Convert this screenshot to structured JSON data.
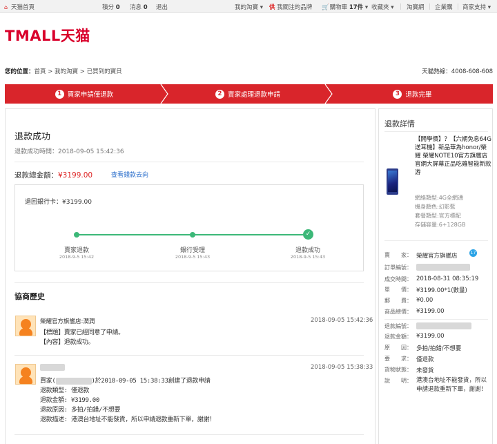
{
  "topbar": {
    "home": "天猫首頁",
    "points_label": "積分",
    "points_value": "0",
    "msg_label": "消息",
    "msg_value": "0",
    "logout": "退出",
    "my_taobao": "我的淘寶",
    "fav_badge": "供",
    "followed_brands": "我關注的品牌",
    "cart_label": "購物車",
    "cart_count": "17件",
    "favorites": "收藏夾",
    "taobao": "淘寶網",
    "enterprise": "企業購",
    "merchant": "商家支持"
  },
  "logo": "TMALL天猫",
  "breadcrumb": {
    "label": "您的位置：",
    "path": "首頁 > 我的淘寶 > 已買到的寶貝",
    "hotline": "天貓熱線：4008-608-608"
  },
  "steps": [
    {
      "num": "1",
      "label": "買家申請僅退款"
    },
    {
      "num": "2",
      "label": "賣家處理退款申請"
    },
    {
      "num": "3",
      "label": "退款完畢"
    }
  ],
  "main": {
    "title": "退款成功",
    "success_time": "退款成功時間：2018-09-05 15:42:36",
    "total_label": "退款總金額：",
    "total_amount": "¥3199.00",
    "trace_link": "查看錢款去向",
    "bank_refund": "退回銀行卡：¥3199.00",
    "timeline": [
      {
        "label": "賣家退款",
        "date": "2018-9-5 15:42"
      },
      {
        "label": "銀行受理",
        "date": "2018-9-5 15:43"
      },
      {
        "label": "退款成功",
        "date": "2018-9-5 15:43"
      }
    ],
    "history_title": "協商歷史",
    "messages": [
      {
        "name": "榮耀官方旗艦店:潤潤",
        "time": "2018-09-05 15:42:36",
        "lines": [
          "【標題】賣家已經同意了申請。",
          "【內容】退款成功。"
        ]
      },
      {
        "name": "",
        "time": "2018-09-05 15:38:33",
        "lines_prefix": "買家(",
        "line1_suffix": ")於2018-09-05 15:38:33創建了退款申請",
        "lines": [
          "退款類型: 僅退款",
          "退款金額: ¥3199.00",
          "退款原因: 多拍/拍錯/不想要",
          "退款描述: 港澳台地址不能發貨，所以申請退款重新下單，謝謝！"
        ]
      }
    ]
  },
  "side": {
    "title": "退款詳情",
    "product": "【開學價】？【六期免息64G送耳機】新品華為honor/榮耀 榮耀NOTE10官方旗艦店官網大屏幕正品吃雞智能新款游",
    "specs": [
      "網絡類型:4G全網通",
      "機身顏色:幻影藍",
      "套餐類型:官方標配",
      "存儲容量:6+128GB"
    ],
    "order": [
      {
        "k": "賣　　家：",
        "v": "榮耀官方旗艦店"
      },
      {
        "k": "訂單編號：",
        "v": ""
      },
      {
        "k": "成交時間：",
        "v": "2018-08-31 08:35:19"
      },
      {
        "k": "單　　價：",
        "v": "¥3199.00*1(數量)"
      },
      {
        "k": "郵　　費：",
        "v": "¥0.00"
      },
      {
        "k": "商品總價：",
        "v": "¥3199.00"
      }
    ],
    "refund": [
      {
        "k": "退款編號：",
        "v": ""
      },
      {
        "k": "退款金額：",
        "v": "¥3199.00"
      },
      {
        "k": "原　　因：",
        "v": "多拍/拍錯/不想要"
      },
      {
        "k": "要　　求：",
        "v": "僅退款"
      },
      {
        "k": "貨物狀態：",
        "v": "未發貨"
      },
      {
        "k": "說　　明：",
        "v": "港澳台地址不能發貨，所以申請退款重新下單，謝謝！"
      }
    ],
    "bird_badge": "17"
  },
  "colors": {
    "brand": "#d9002b",
    "step_bar": "#d9252b",
    "success": "#3cb878",
    "link": "#2a6ecb"
  }
}
